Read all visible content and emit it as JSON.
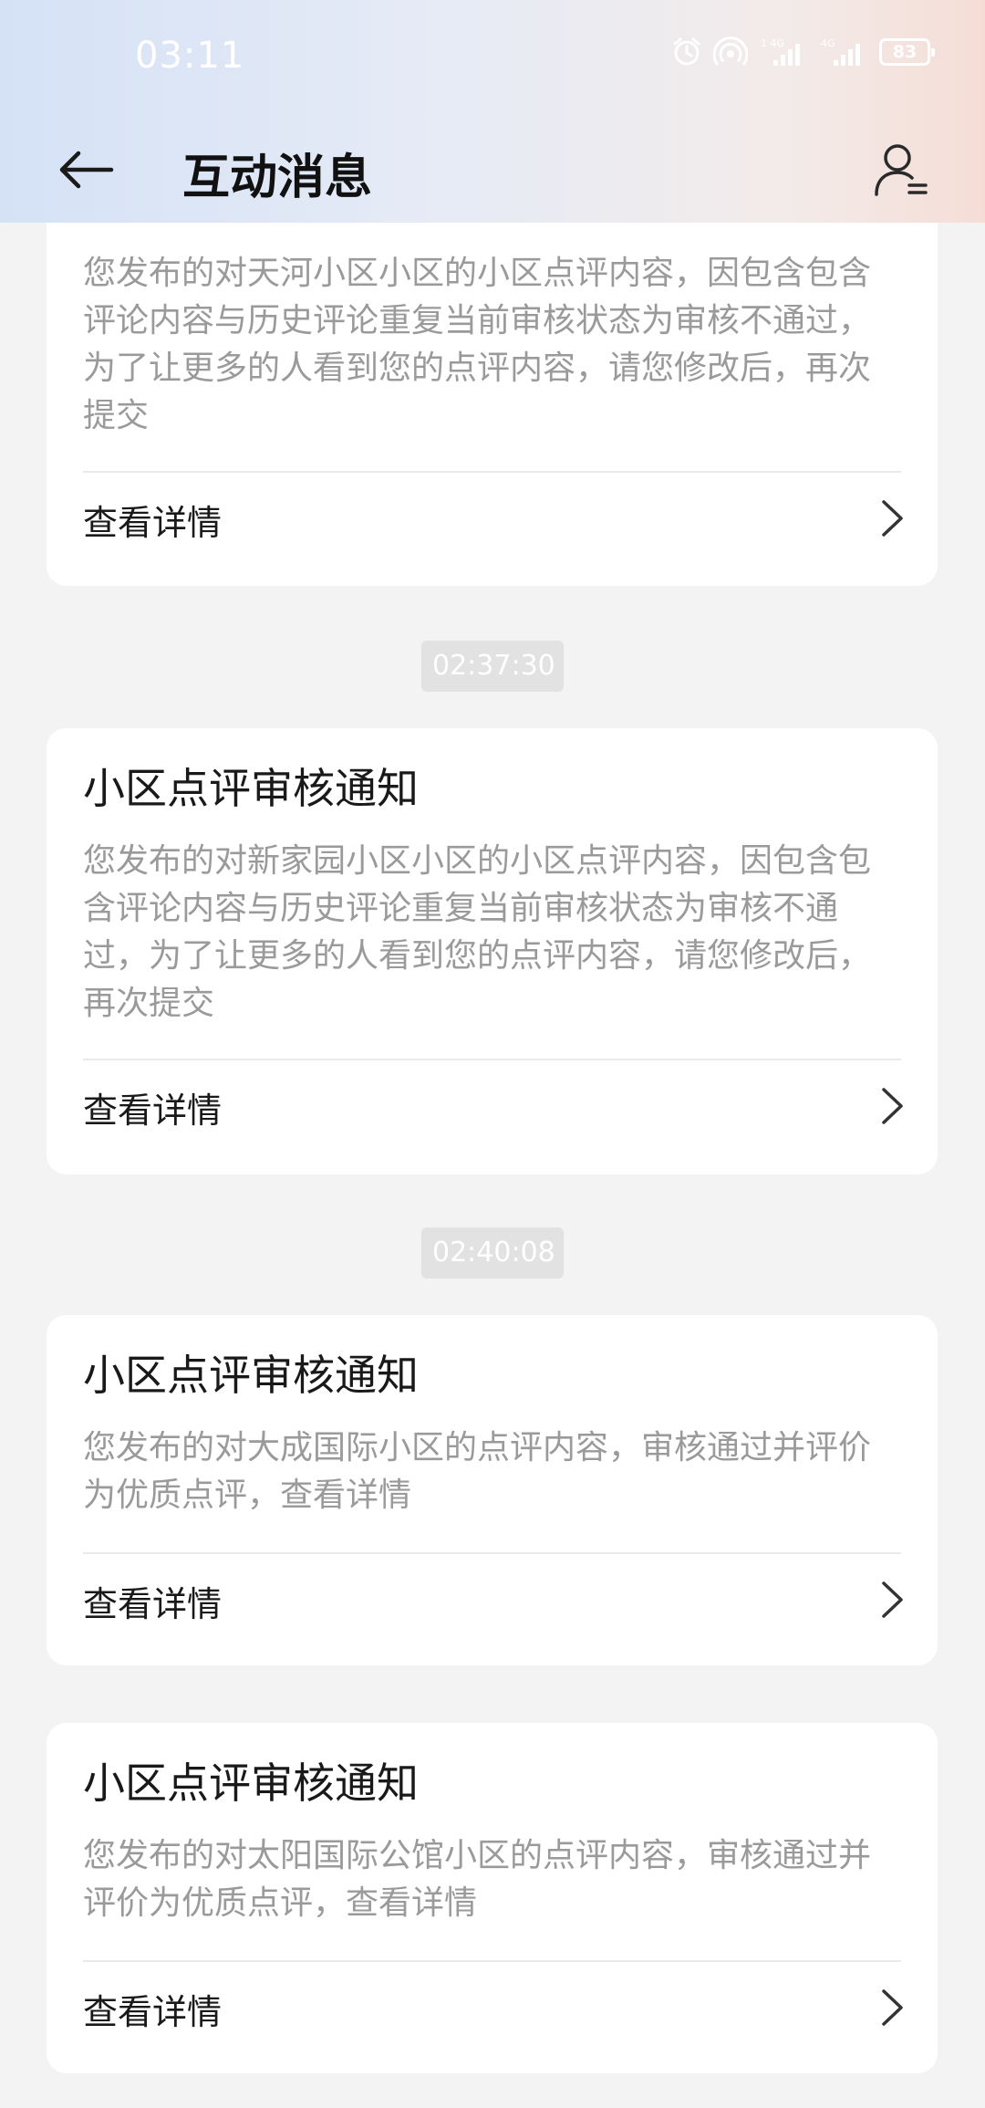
{
  "status_bar": {
    "time": "03:11",
    "battery": "83",
    "icons": [
      "alarm-icon",
      "hotspot-icon",
      "signal-4g-icon",
      "signal-4g-icon-2",
      "battery-icon"
    ]
  },
  "header": {
    "title": "互动消息",
    "back_icon": "arrow-left-icon",
    "account_icon": "account-settings-icon"
  },
  "messages": [
    {
      "title": "",
      "body": "您发布的对天河小区小区的小区点评内容，因包含包含评论内容与历史评论重复当前审核状态为审核不通过，为了让更多的人看到您的点评内容，请您修改后，再次提交",
      "action": "查看详情"
    },
    {
      "time": "02:37:30",
      "title": "小区点评审核通知",
      "body": "您发布的对新家园小区小区的小区点评内容，因包含包含评论内容与历史评论重复当前审核状态为审核不通过，为了让更多的人看到您的点评内容，请您修改后，再次提交",
      "action": "查看详情"
    },
    {
      "time": "02:40:08",
      "title": "小区点评审核通知",
      "body": "您发布的对大成国际小区的点评内容，审核通过并评价为优质点评，查看详情",
      "action": "查看详情"
    },
    {
      "title": "小区点评审核通知",
      "body": "您发布的对太阳国际公馆小区的点评内容，审核通过并评价为优质点评，查看详情",
      "action": "查看详情"
    }
  ],
  "colors": {
    "page_background": "#f3f3f3",
    "card_background": "#ffffff",
    "body_text": "#9a9a9a",
    "title_text": "#191919",
    "time_badge": "#e2e2e2"
  }
}
